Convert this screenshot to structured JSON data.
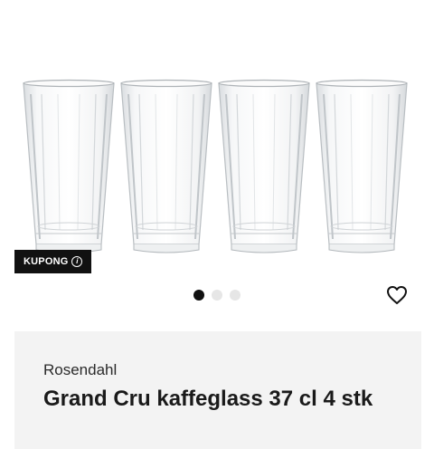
{
  "product": {
    "image_alt": "Four clear faceted drinking glasses",
    "coupon_label": "KUPONG",
    "coupon_icon": "info-icon",
    "carousel": {
      "total": 3,
      "active_index": 0
    },
    "favorite_icon": "heart-outline-icon",
    "brand": "Rosendahl",
    "title": "Grand Cru kaffeglass 37 cl 4 stk"
  },
  "colors": {
    "badge_bg": "#111111",
    "dot_active": "#111111",
    "dot_inactive": "#e6e6e6",
    "card_bg": "#f3f3f3"
  }
}
